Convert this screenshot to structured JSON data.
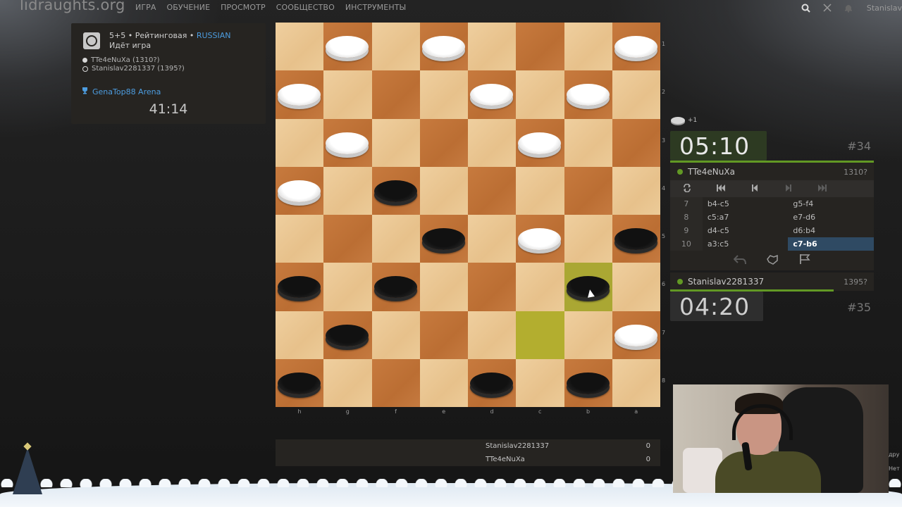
{
  "site": {
    "logo": "lidraughts.org"
  },
  "nav": [
    "ИГРА",
    "ОБУЧЕНИЕ",
    "ПРОСМОТР",
    "СООБЩЕСТВО",
    "ИНСТРУМЕНТЫ"
  ],
  "top_user": "Stanislav",
  "game_info": {
    "line1_prefix": "5+5 • Рейтинговая • ",
    "variant": "RUSSIAN",
    "status": "Идёт игра",
    "white_player": "TTe4eNuXa (1310?)",
    "black_player": "Stanislav2281337 (1395?)",
    "arena_name": "GenaTop88 Arena",
    "arena_time": "41:14"
  },
  "board": {
    "files": [
      "h",
      "g",
      "f",
      "e",
      "d",
      "c",
      "b",
      "a"
    ],
    "ranks": [
      "1",
      "2",
      "3",
      "4",
      "5",
      "6",
      "7",
      "8"
    ],
    "pieces": [
      [
        "",
        "w",
        "",
        "w",
        "",
        "",
        "",
        "w"
      ],
      [
        "w",
        "",
        "",
        "",
        "w",
        "",
        "w",
        ""
      ],
      [
        "",
        "w",
        "",
        "",
        "",
        "w",
        "",
        ""
      ],
      [
        "w",
        "",
        "b",
        "",
        "",
        "",
        "",
        ""
      ],
      [
        "",
        "",
        "",
        "b",
        "",
        "w",
        "",
        "b"
      ],
      [
        "b",
        "",
        "b",
        "",
        "",
        "",
        "b",
        ""
      ],
      [
        "",
        "b",
        "",
        "",
        "",
        "",
        "",
        "w"
      ],
      [
        "b",
        "",
        "",
        "",
        "b",
        "",
        "b",
        ""
      ]
    ],
    "highlight_squares": [
      [
        5,
        6
      ],
      [
        6,
        5
      ]
    ]
  },
  "right_panel": {
    "captured_count": "+1",
    "top_clock": {
      "minutes": "05",
      "seconds": "10",
      "move_number": "#34"
    },
    "top_player": {
      "name": "TTe4eNuXa",
      "rating": "1310?"
    },
    "moves": [
      {
        "n": "7",
        "w": "b4-c5",
        "b": "g5-f4"
      },
      {
        "n": "8",
        "w": "c5:a7",
        "b": "e7-d6"
      },
      {
        "n": "9",
        "w": "d4-c5",
        "b": "d6:b4"
      },
      {
        "n": "10",
        "w": "a3:c5",
        "b": "c7-b6"
      }
    ],
    "bottom_player": {
      "name": "Stanislav2281337",
      "rating": "1395?"
    },
    "bottom_clock": {
      "minutes": "04",
      "seconds": "20",
      "move_number": "#35"
    }
  },
  "scoreboard": [
    {
      "name": "Stanislav2281337",
      "score": "0"
    },
    {
      "name": "TTe4eNuXa",
      "score": "0"
    }
  ],
  "side_texts": [
    "дру",
    "Нет"
  ]
}
